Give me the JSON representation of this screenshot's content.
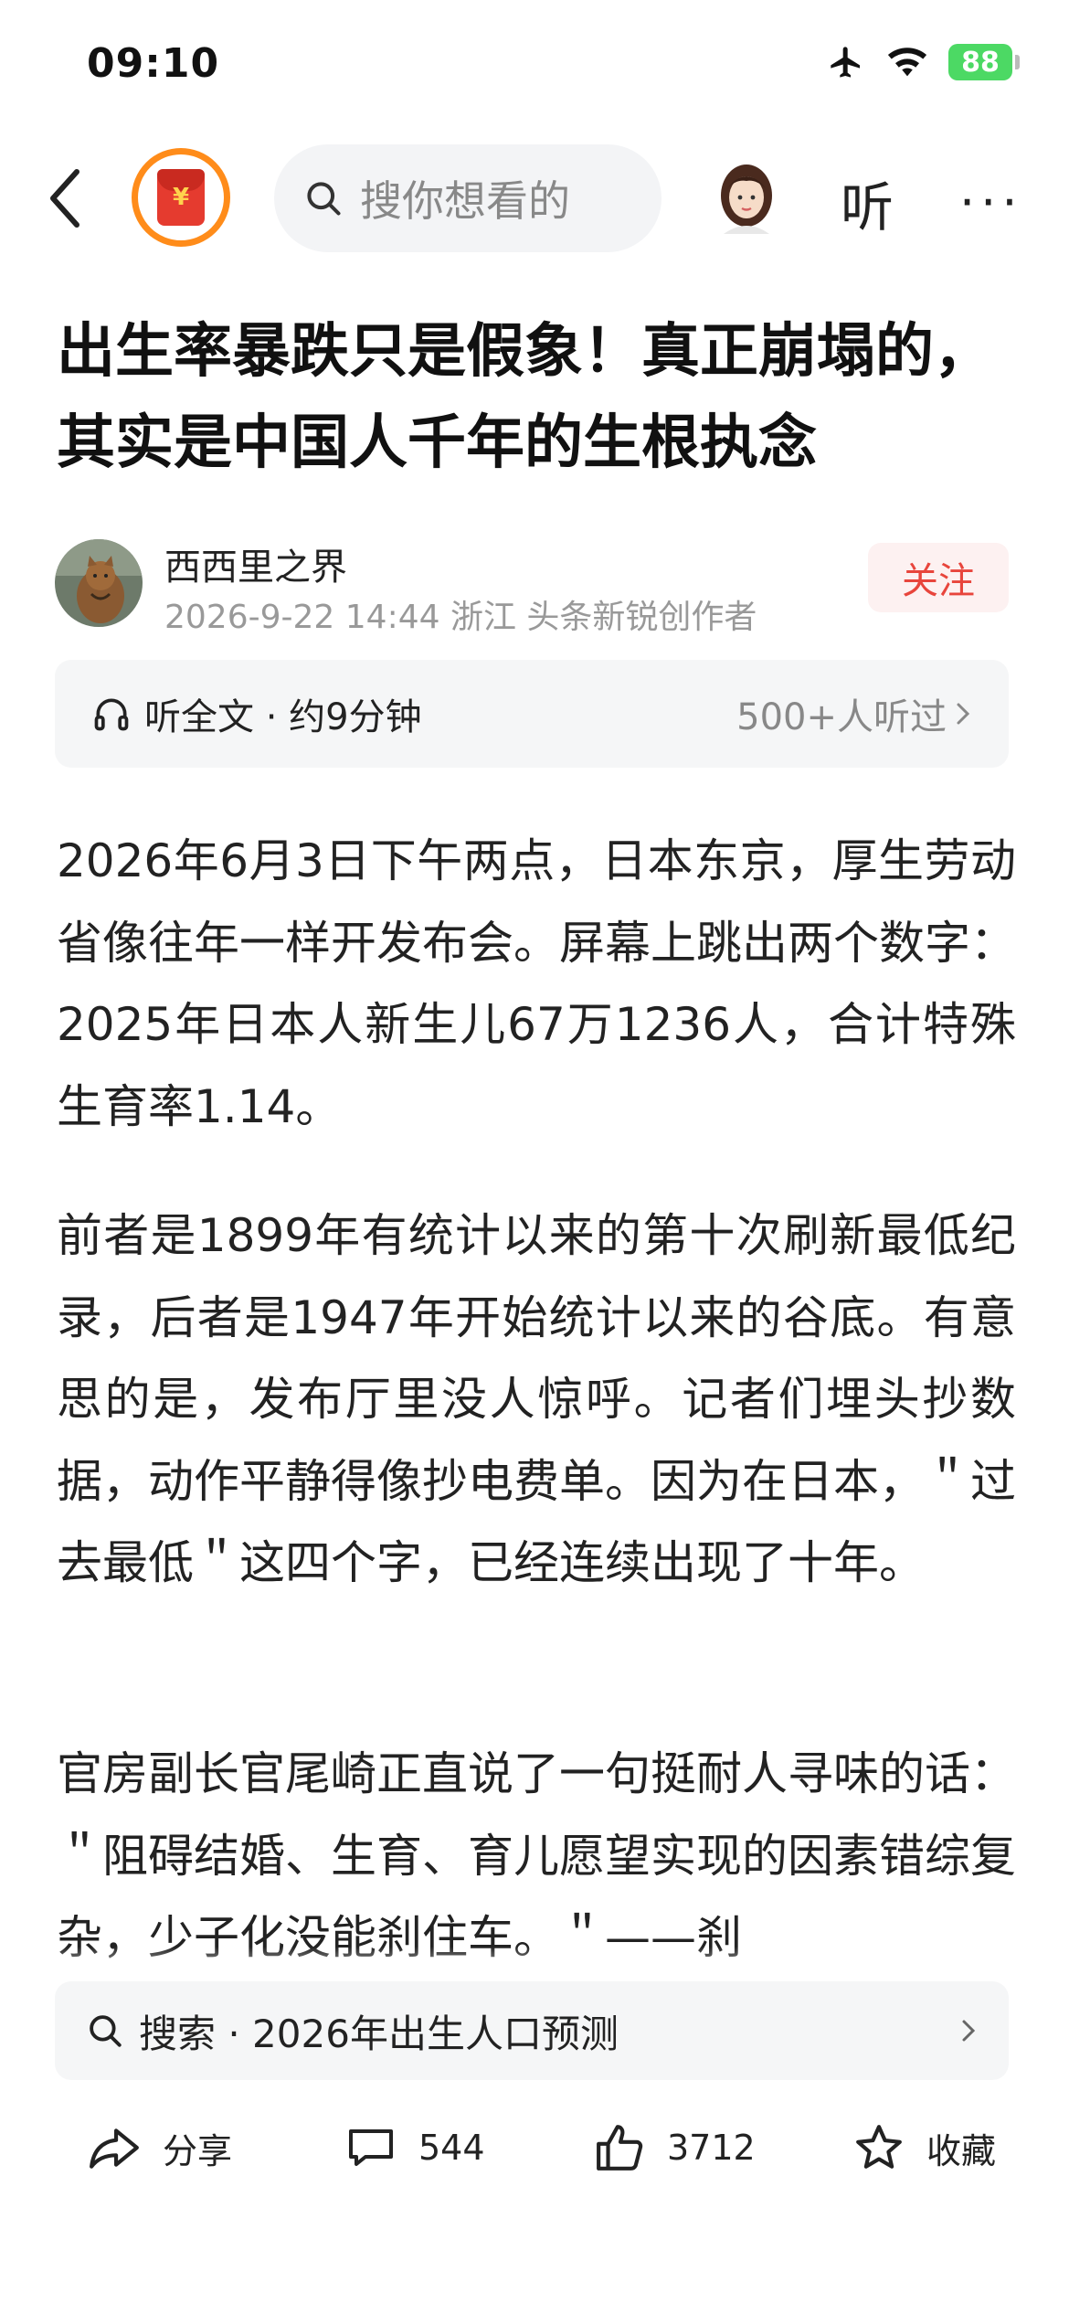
{
  "status_bar": {
    "time": "09:10",
    "battery": "88"
  },
  "nav": {
    "search_placeholder": "搜你想看的",
    "listen_label": "听",
    "more_label": "···"
  },
  "article": {
    "title": "出生率暴跌只是假象！真正崩塌的，其实是中国人千年的生根执念",
    "author": {
      "name": "西西里之界",
      "meta": "2026-9-22  14:44  浙江  头条新锐创作者",
      "follow_label": "关注"
    },
    "listen_bar": {
      "label": "听全文 · 约9分钟",
      "count": "500+人听过"
    },
    "paragraphs": [
      "2026年6月3日下午两点，日本东京，厚生劳动省像往年一样开发布会。屏幕上跳出两个数字：2025年日本人新生儿67万1236人，合计特殊生育率1.14。",
      "前者是1899年有统计以来的第十次刷新最低纪录，后者是1947年开始统计以来的谷底。有意思的是，发布厅里没人惊呼。记者们埋头抄数据，动作平静得像抄电费单。因为在日本，＂过去最低＂这四个字，已经连续出现了十年。",
      "官房副长官尾崎正直说了一句挺耐人寻味的话：＂阻碍结婚、生育、育儿愿望实现的因素错综复杂，少子化没能刹住车。＂——刹"
    ]
  },
  "bottom": {
    "search_suggest": "搜索 · 2026年出生人口预测",
    "actions": {
      "share": "分享",
      "comments": "544",
      "likes": "3712",
      "favorite": "收藏"
    }
  }
}
